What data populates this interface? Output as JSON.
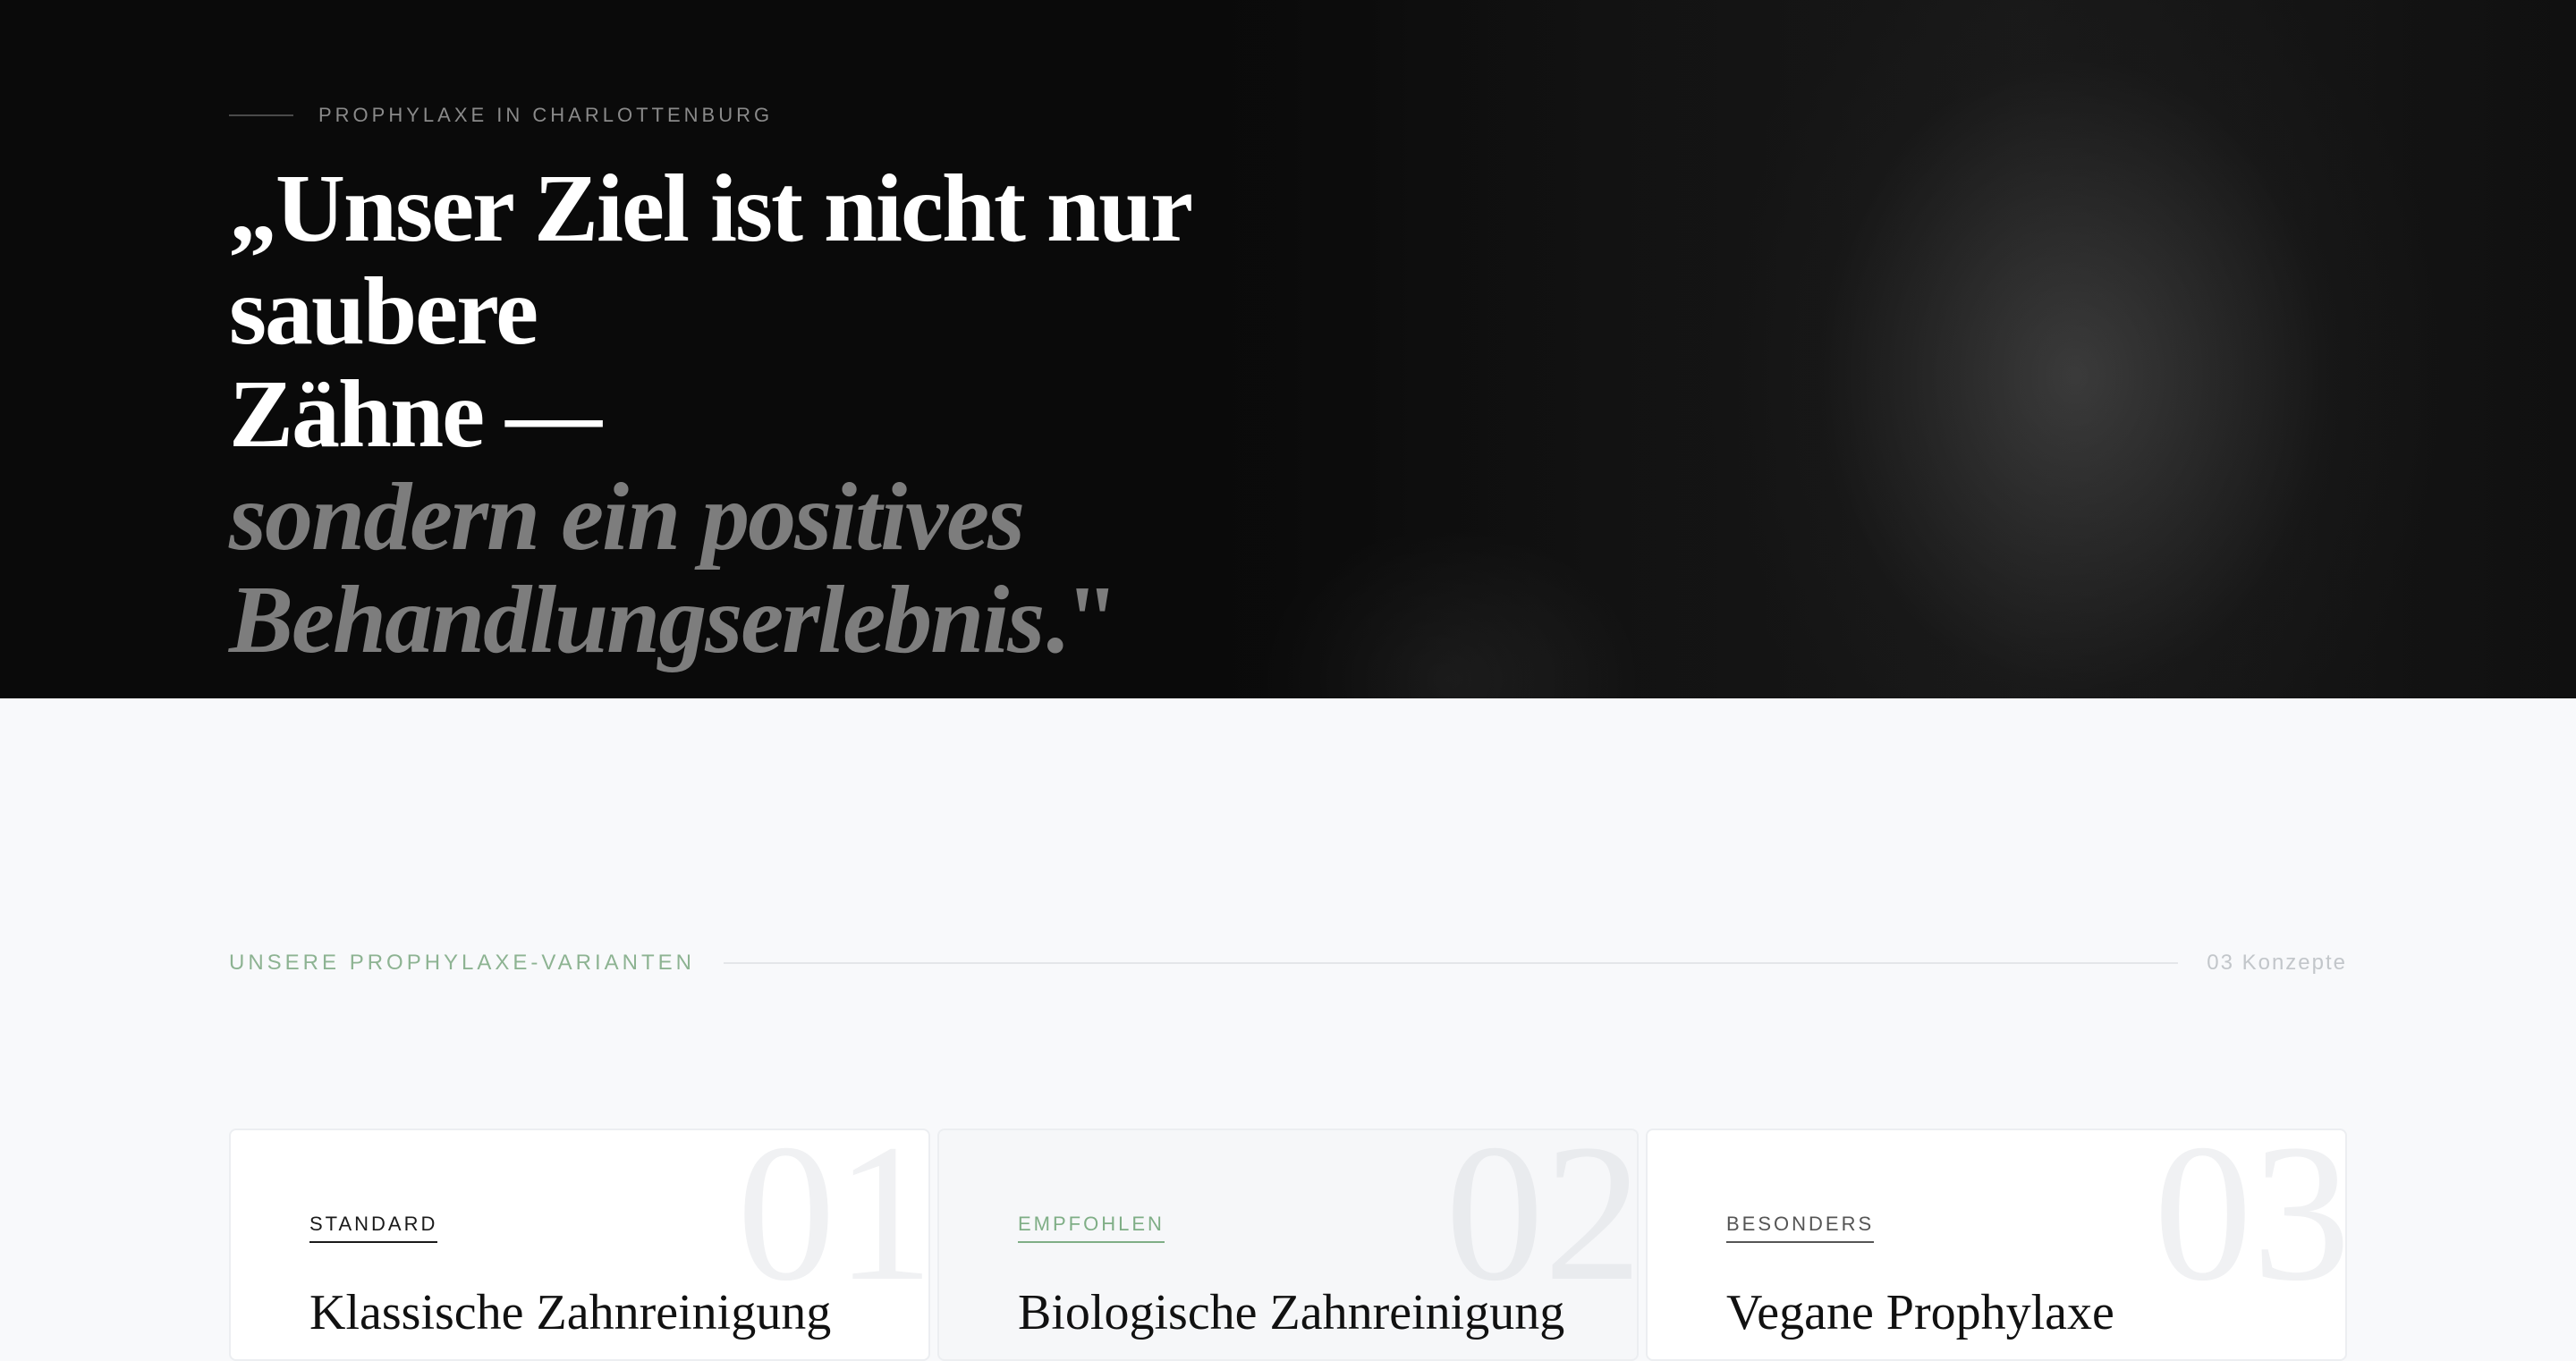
{
  "hero": {
    "eyebrow": "PROPHYLAXE IN CHARLOTTENBURG",
    "quote_line1": "„Unser Ziel ist nicht nur saubere",
    "quote_line2": "Zähne —",
    "quote_line3": "sondern ein positives",
    "quote_line4": "Behandlungserlebnis",
    "quote_end": ".\""
  },
  "variants": {
    "title": "UNSERE PROPHYLAXE-VARIANTEN",
    "count": "03 Konzepte",
    "cards": [
      {
        "number": "01",
        "tag": "STANDARD",
        "title": "Klassische Zahnreinigung"
      },
      {
        "number": "02",
        "tag": "EMPFOHLEN",
        "title": "Biologische Zahnreinigung"
      },
      {
        "number": "03",
        "tag": "BESONDERS",
        "title": "Vegane Prophylaxe"
      }
    ]
  },
  "colors": {
    "hero_bg": "#0a0a0a",
    "accent_green": "#8db392",
    "page_bg": "#f8f9fb"
  }
}
